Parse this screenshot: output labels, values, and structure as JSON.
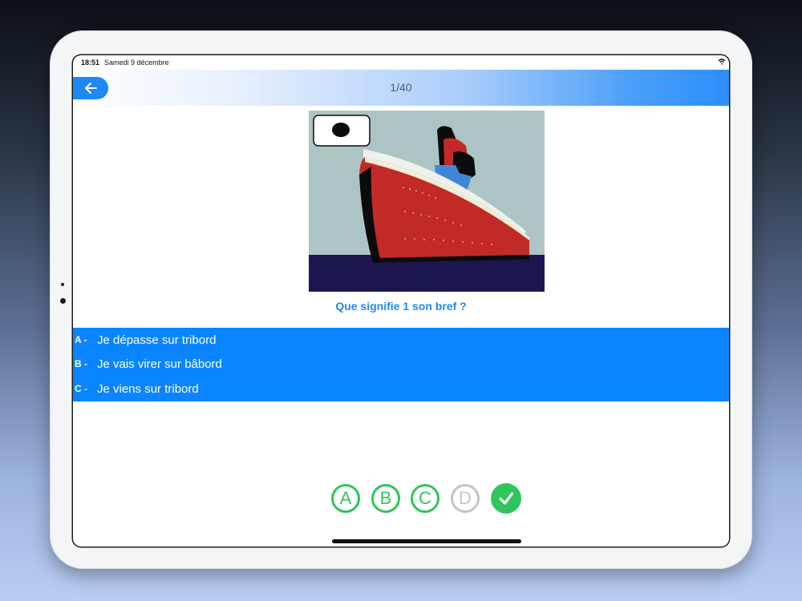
{
  "status_bar": {
    "time": "18:51",
    "date": "Samedi 9 décembre"
  },
  "nav": {
    "title": "1/40",
    "back_icon": "arrow-left-icon"
  },
  "quiz": {
    "question": "Que signifie 1 son bref ?",
    "answers": [
      {
        "letter": "A -",
        "text": "Je dépasse sur tribord"
      },
      {
        "letter": "B -",
        "text": "Je vais virer sur bâbord"
      },
      {
        "letter": "C -",
        "text": "Je viens sur tribord"
      }
    ],
    "choices": [
      {
        "label": "A",
        "state": "available"
      },
      {
        "label": "B",
        "state": "available"
      },
      {
        "label": "C",
        "state": "available"
      },
      {
        "label": "D",
        "state": "disabled"
      },
      {
        "label": "✓",
        "state": "validate"
      }
    ]
  },
  "colors": {
    "accent": "#0a84ff",
    "title_blue": "#1e88f4",
    "choice_green": "#2fc55a",
    "choice_disabled": "#c4c4c4",
    "ship_hull": "#c22a28",
    "sky": "#adc4c4",
    "sea": "#1b1650"
  }
}
